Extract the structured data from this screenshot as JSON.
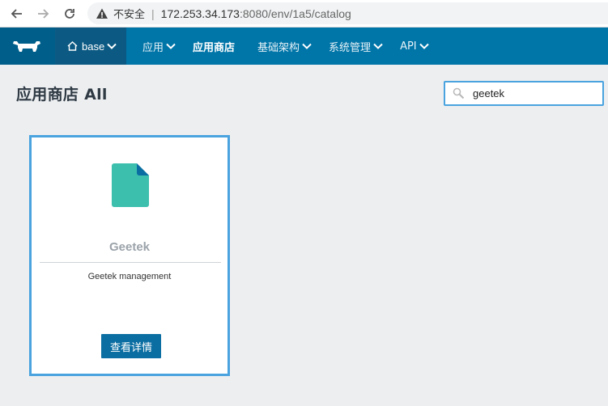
{
  "browser": {
    "security_label": "不安全",
    "url_host": "172.253.34.173",
    "url_path": ":8080/env/1a5/catalog"
  },
  "header": {
    "env_name": "base",
    "menu": [
      {
        "label": "应用",
        "has_dropdown": true,
        "active": false
      },
      {
        "label": "应用商店",
        "has_dropdown": false,
        "active": true
      },
      {
        "label": "基础架构",
        "has_dropdown": true,
        "active": false
      },
      {
        "label": "系统管理",
        "has_dropdown": true,
        "active": false
      },
      {
        "label": "API",
        "has_dropdown": true,
        "active": false
      }
    ]
  },
  "page": {
    "title": "应用商店 All",
    "search_value": "geetek"
  },
  "catalog": [
    {
      "name": "Geetek",
      "description": "Geetek management",
      "button_label": "查看详情",
      "icon": "file-icon"
    }
  ],
  "colors": {
    "topbar": "#0075a8",
    "accent_border": "#4aa3df",
    "file_icon": "#3dbfae",
    "button": "#0b6ea2"
  }
}
